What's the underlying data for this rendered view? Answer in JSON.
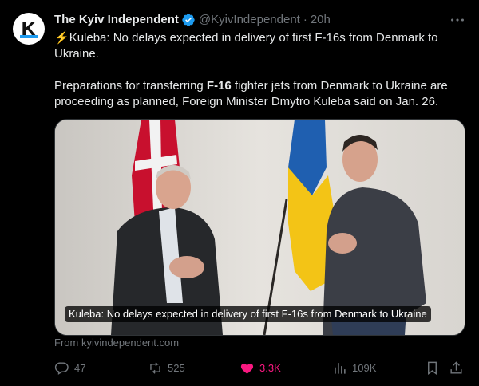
{
  "author": {
    "name": "The Kyiv Independent",
    "handle": "@KyivIndependent",
    "separator": "·",
    "time": "20h",
    "avatar_letter": "K"
  },
  "tweet": {
    "headline_icon": "⚡",
    "headline": "Kuleba: No delays expected in delivery of first F-16s from Denmark to Ukraine.",
    "body_before": "Preparations for transferring ",
    "body_bold": "F-16",
    "body_after": " fighter jets from Denmark to Ukraine are proceeding as planned, Foreign Minister Dmytro Kuleba said on Jan. 26."
  },
  "card": {
    "caption": "Kuleba: No delays expected in delivery of first F-16s from Denmark to Ukraine",
    "source": "From kyivindependent.com"
  },
  "actions": {
    "replies": "47",
    "reposts": "525",
    "likes": "3.3K",
    "views": "109K"
  },
  "icons": {
    "verified": "verified-badge-icon",
    "more": "more-horizontal-icon",
    "reply": "reply-icon",
    "repost": "repost-icon",
    "like": "heart-icon",
    "views": "views-chart-icon",
    "bookmark": "bookmark-icon",
    "share": "share-icon"
  },
  "colors": {
    "background": "#000000",
    "text": "#e7e9ea",
    "secondary": "#71767b",
    "accent": "#1d9bf0",
    "like": "#f91880"
  }
}
